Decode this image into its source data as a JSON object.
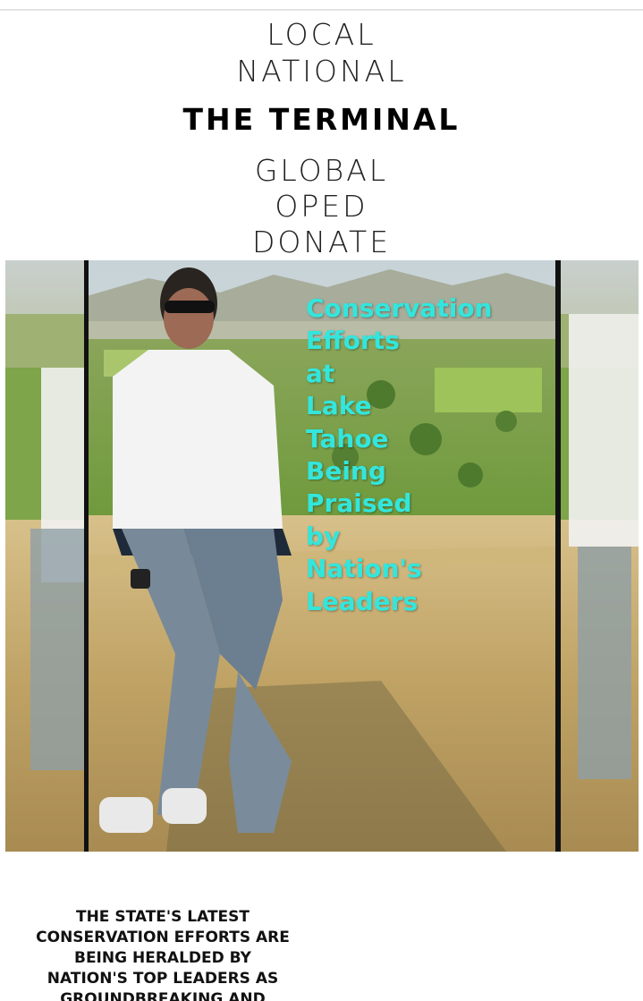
{
  "nav": {
    "local": "LOCAL",
    "national": "NATIONAL",
    "global": "GLOBAL",
    "oped": "OPED",
    "donate": "DONATE"
  },
  "site": {
    "title": "THE TERMINAL"
  },
  "hero": {
    "headline": "Conservation\nEfforts\n at\nLake\nTahoe\nBeing\nPraised\nby\nNation's\nLeaders",
    "headline_color": "#33e6dc"
  },
  "article": {
    "summary": "THE STATE'S LATEST CONSERVATION EFFORTS ARE BEING HERALDED BY NATION'S TOP LEADERS AS GROUNDBREAKING AND"
  }
}
